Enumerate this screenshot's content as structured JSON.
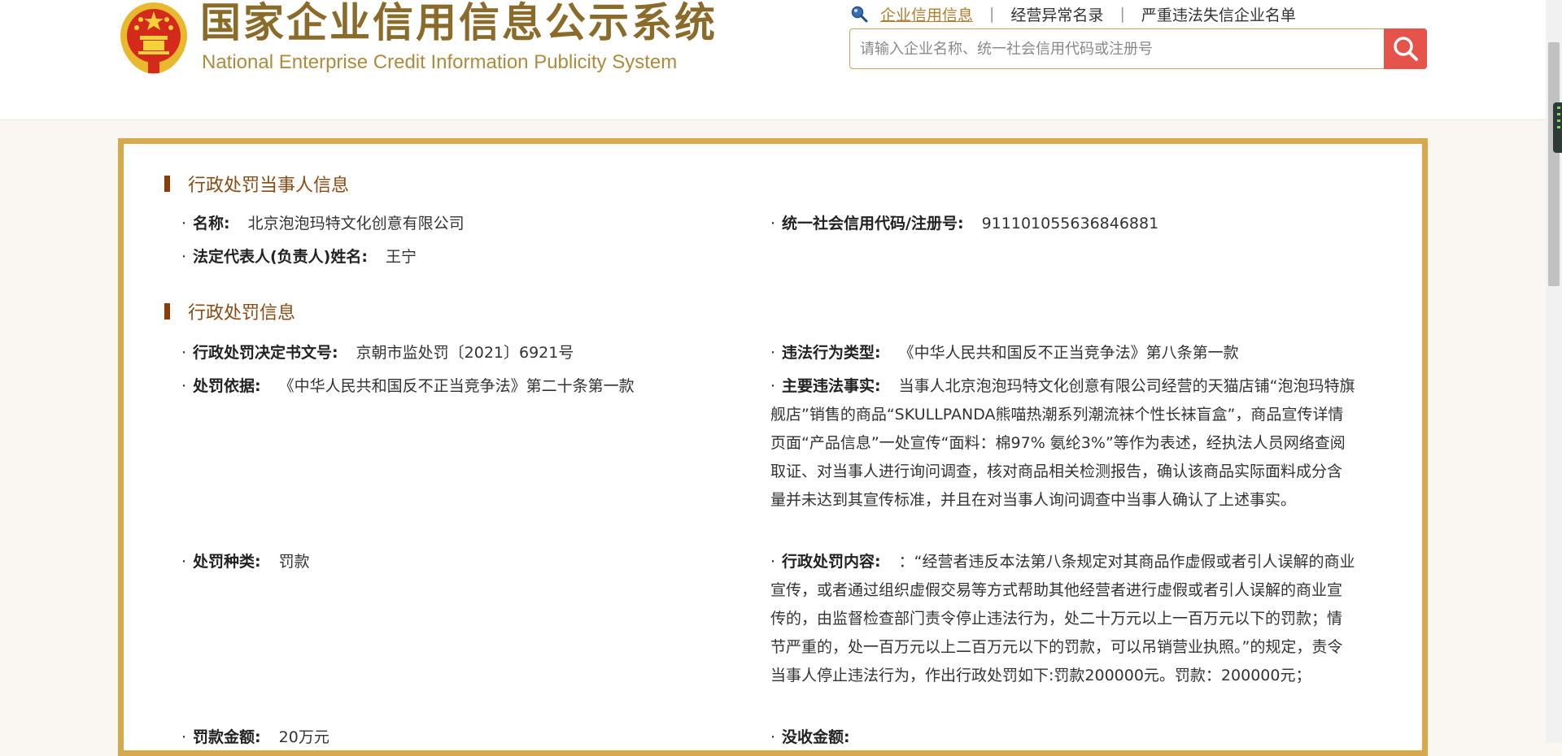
{
  "header": {
    "logo_cn": "国家企业信用信息公示系统",
    "logo_en": "National Enterprise Credit Information Publicity System",
    "nav": [
      {
        "label": "企业信用信息"
      },
      {
        "label": "经营异常名录"
      },
      {
        "label": "严重违法失信企业名单"
      }
    ],
    "search": {
      "placeholder": "请输入企业名称、统一社会信用代码或注册号",
      "value": ""
    }
  },
  "party_section": {
    "title": "行政处罚当事人信息",
    "name_label": "名称:",
    "name_value": "北京泡泡玛特文化创意有限公司",
    "credit_label": "统一社会信用代码/注册号:",
    "credit_value": "911101055636846881",
    "legal_rep_label": "法定代表人(负责人)姓名:",
    "legal_rep_value": "王宁"
  },
  "penalty_section": {
    "title": "行政处罚信息",
    "decision_no_label": "行政处罚决定书文号:",
    "decision_no_value": "京朝市监处罚〔2021〕6921号",
    "violation_type_label": "违法行为类型:",
    "violation_type_value": "《中华人民共和国反不正当竞争法》第八条第一款",
    "basis_label": "处罚依据:",
    "basis_value": "《中华人民共和国反不正当竞争法》第二十条第一款",
    "facts_label": "主要违法事实:",
    "facts_value": "当事人北京泡泡玛特文化创意有限公司经营的天猫店铺“泡泡玛特旗舰店”销售的商品“SKULLPANDA熊喵热潮系列潮流袜个性长袜盲盒”，商品宣传详情页面“产品信息”一处宣传“面料：棉97% 氨纶3%”等作为表述，经执法人员网络查阅取证、对当事人进行询问调查，核对商品相关检测报告，确认该商品实际面料成分含量并未达到其宣传标准，并且在对当事人询问调查中当事人确认了上述事实。",
    "penalty_type_label": "处罚种类:",
    "penalty_type_value": "罚款",
    "penalty_content_label": "行政处罚内容:",
    "penalty_content_value": "：“经营者违反本法第八条规定对其商品作虚假或者引人误解的商业宣传，或者通过组织虚假交易等方式帮助其他经营者进行虚假或者引人误解的商业宣传的，由监督检查部门责令停止违法行为，处二十万元以上一百万元以下的罚款；情节严重的，处一百万元以上二百万元以下的罚款，可以吊销营业执照。”的规定，责令当事人停止违法行为，作出行政处罚如下:罚款200000元。罚款：200000元；",
    "fine_amount_label": "罚款金额:",
    "fine_amount_value": "20万元",
    "confiscation_label": "没收金额:",
    "confiscation_value": ""
  }
}
